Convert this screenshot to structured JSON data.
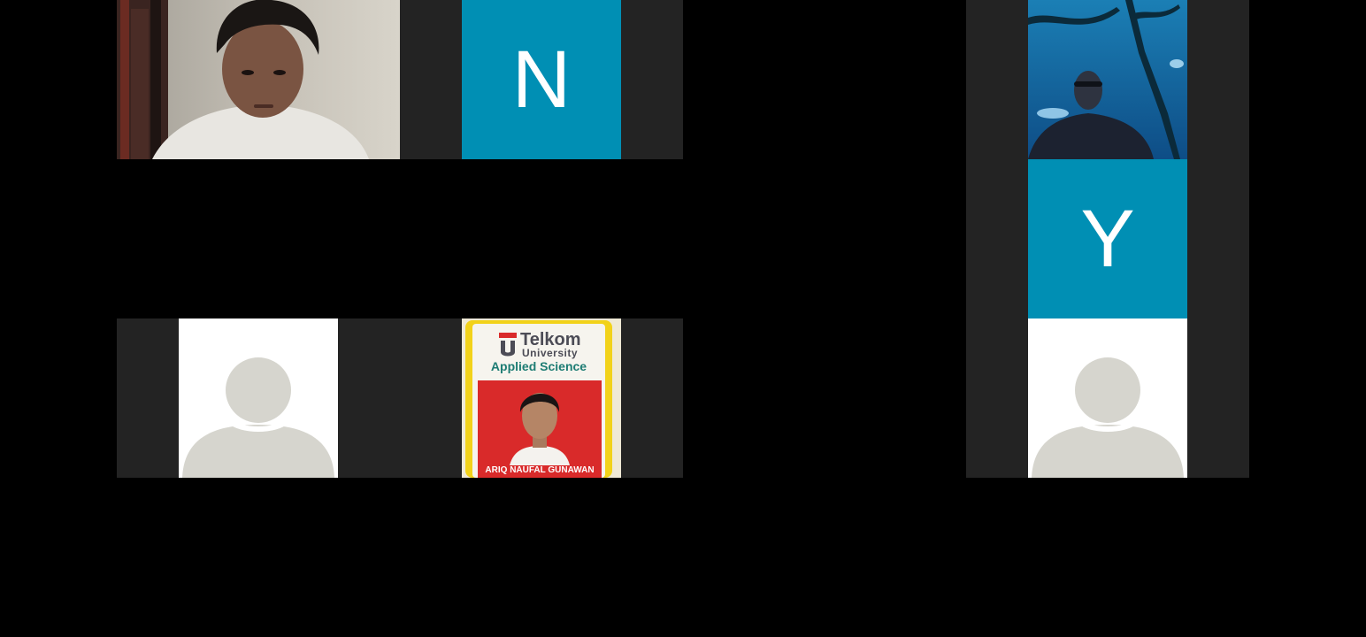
{
  "colors": {
    "background": "#000000",
    "cell_bg": "#232323",
    "avatar_letter_bg": "#008fb4",
    "avatar_silhouette": "#d6d5ce",
    "id_card_yellow": "#f2d21a",
    "id_card_red": "#d92a2a"
  },
  "participants": [
    {
      "type": "video",
      "icon": "webcam-feed"
    },
    {
      "type": "initial",
      "initial": "N"
    },
    {
      "type": "video",
      "icon": "webcam-feed"
    },
    {
      "type": "initial",
      "initial": "Y"
    },
    {
      "type": "default-avatar",
      "icon": "person-placeholder-icon"
    },
    {
      "type": "video",
      "icon": "webcam-feed"
    },
    {
      "type": "default-avatar",
      "icon": "person-placeholder-icon"
    }
  ],
  "id_card": {
    "brand": "Telkom",
    "brand_sub": "University",
    "program": "Applied Science",
    "name": "ARIQ NAUFAL GUNAWAN"
  }
}
